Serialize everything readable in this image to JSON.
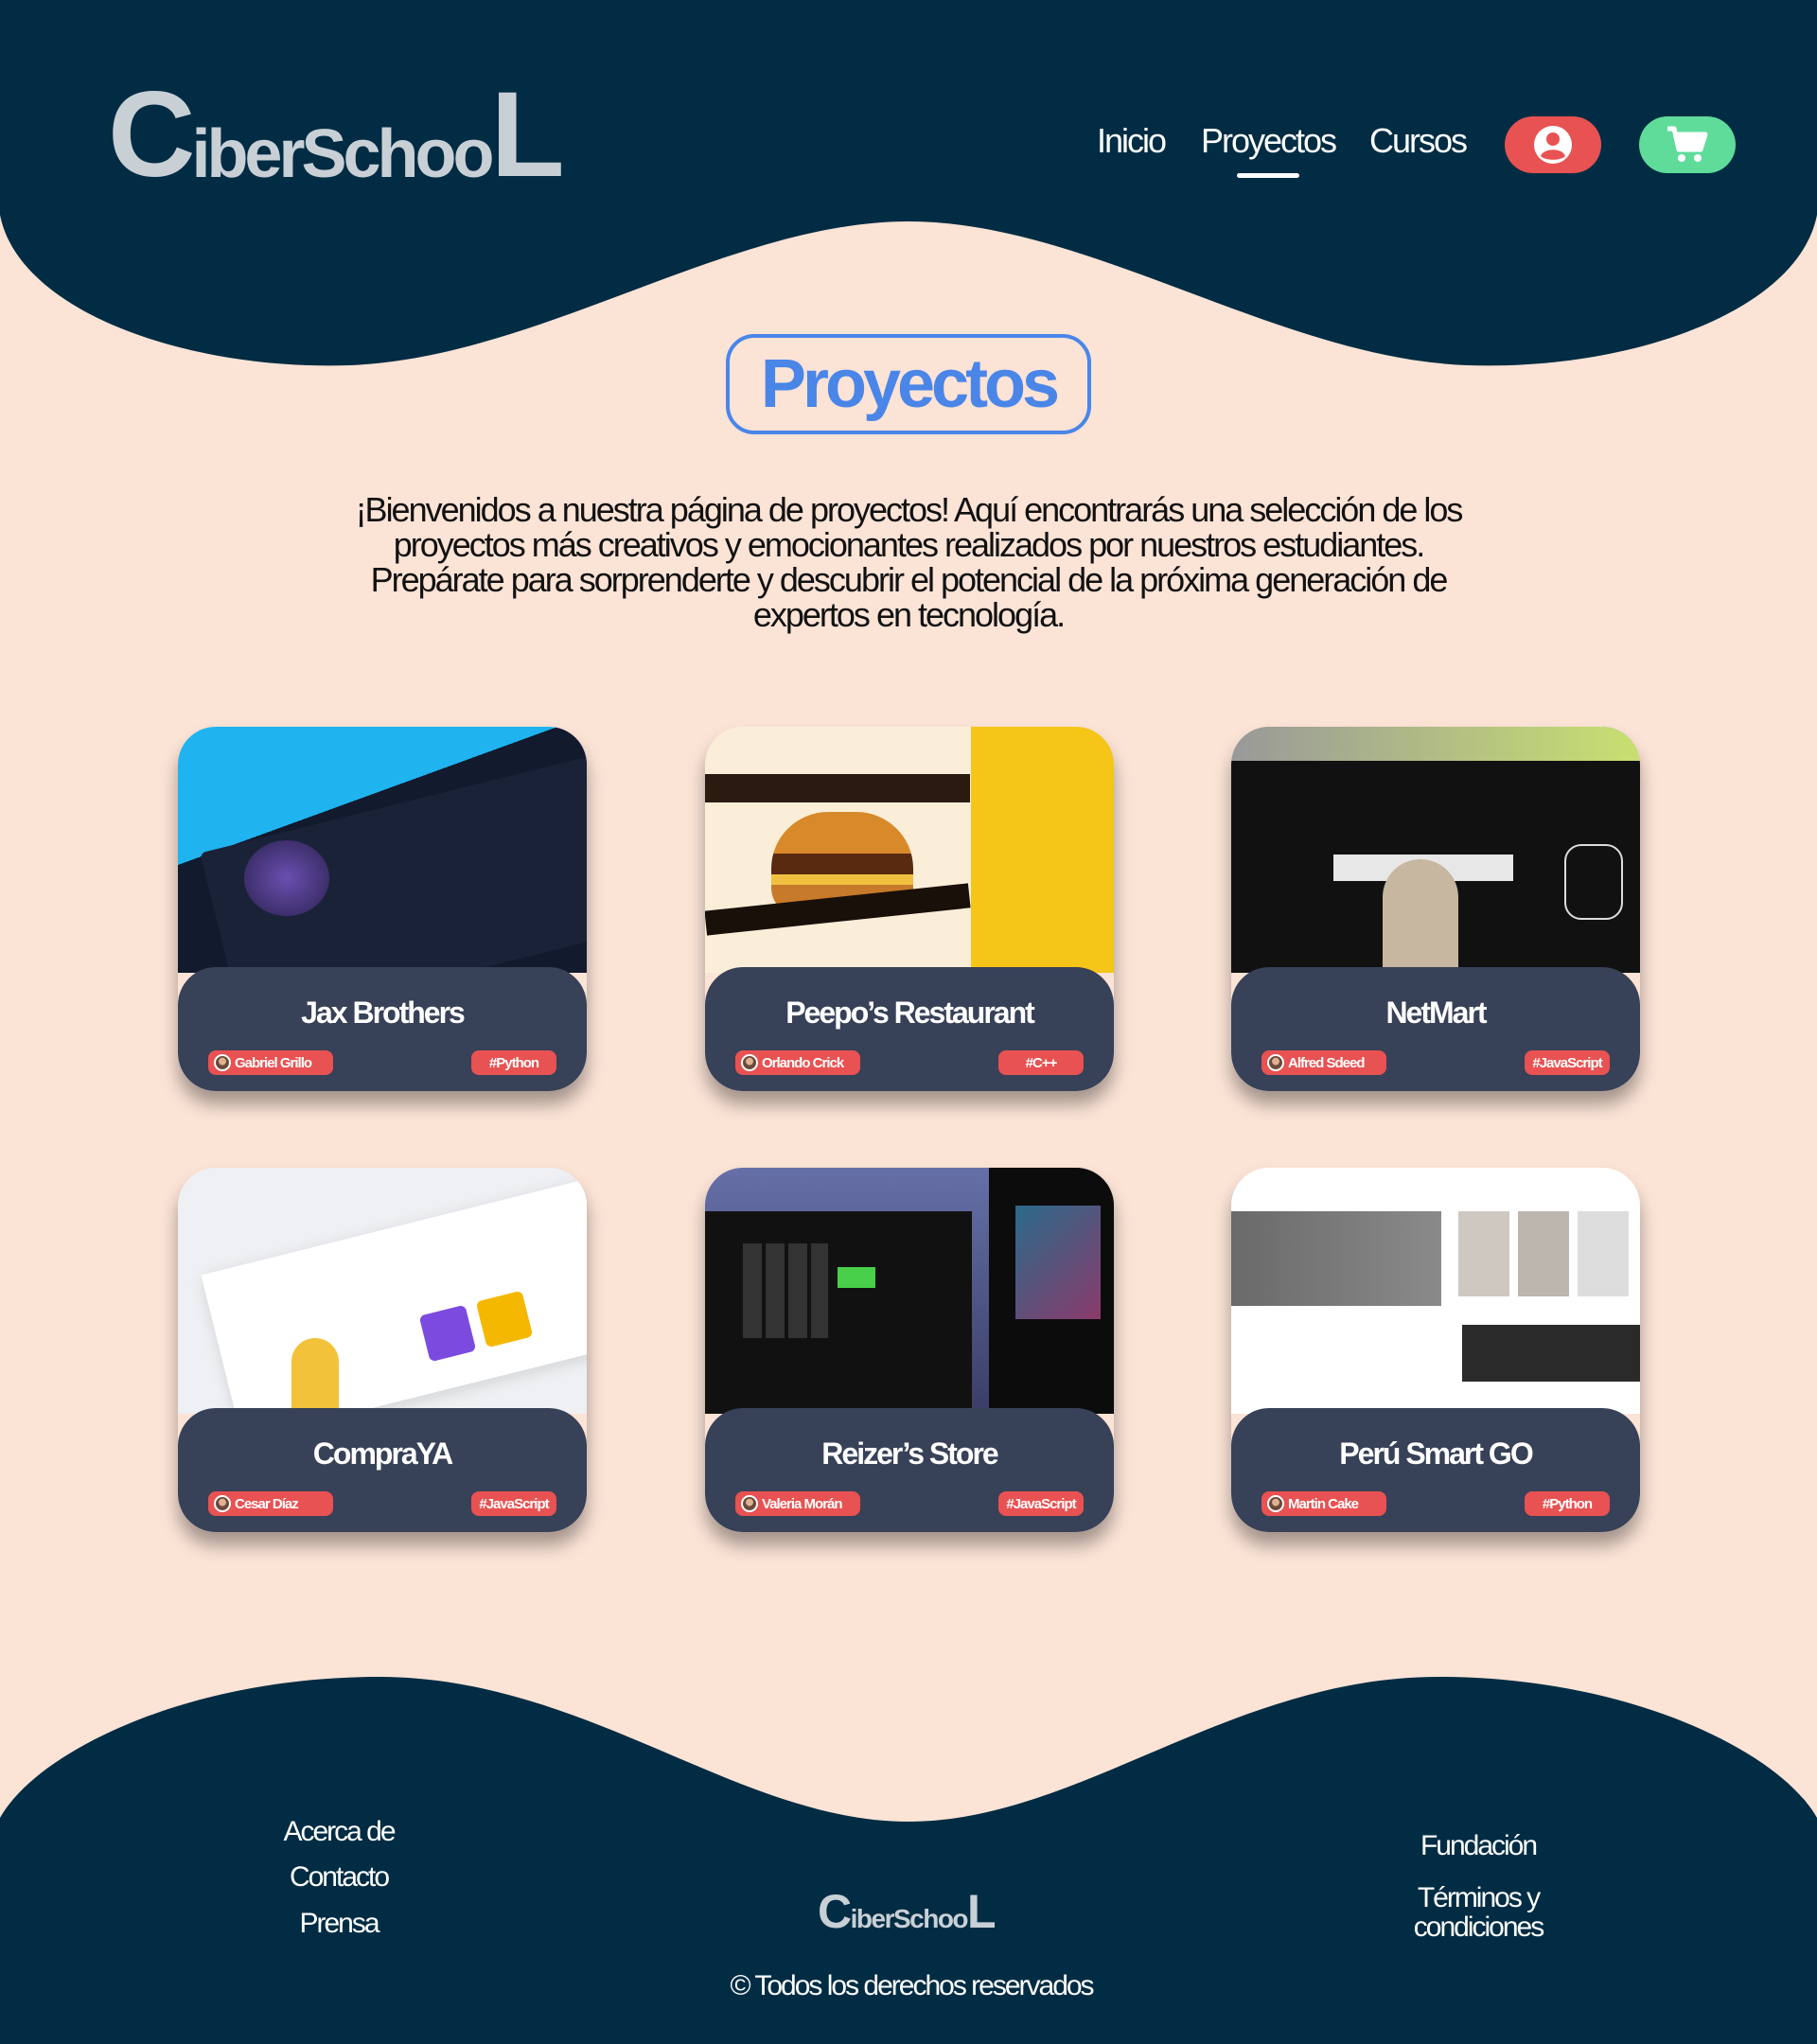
{
  "header": {
    "logo": {
      "c": "C",
      "mid": "iberSchoo",
      "l": "L"
    },
    "nav": [
      {
        "label": "Inicio"
      },
      {
        "label": "Proyectos",
        "active": true
      },
      {
        "label": "Cursos"
      }
    ],
    "user_icon": "user-circle-icon",
    "cart_icon": "cart-icon",
    "colors": {
      "dark": "#012c43",
      "user_button": "#e85252",
      "cart_button": "#5fdc9a"
    }
  },
  "main": {
    "title": "Proyectos",
    "intro": "¡Bienvenidos a nuestra página de proyectos! Aquí encontrarás una selección de los proyectos más creativos y emocionantes realizados por nuestros estudiantes. Prepárate para sorprenderte y descubrir el potencial de la próxima generación de expertos en tecnología.",
    "projects": [
      {
        "name": "Jax Brothers",
        "author": "Gabriel Grillo",
        "tag": "#Python"
      },
      {
        "name": "Peepo’s Restaurant",
        "author": "Orlando Crick",
        "tag": "#C++"
      },
      {
        "name": "NetMart",
        "author": "Alfred Sdeed",
        "tag": "#JavaScript"
      },
      {
        "name": "CompraYA",
        "author": "Cesar Díaz",
        "tag": "#JavaScript"
      },
      {
        "name": "Reizer’s Store",
        "author": "Valeria Morán",
        "tag": "#JavaScript"
      },
      {
        "name": "Perú Smart GO",
        "author": "Martin Cake",
        "tag": "#Python"
      }
    ]
  },
  "footer": {
    "left_links": [
      "Acerca de",
      "Contacto",
      "Prensa"
    ],
    "right_links": [
      "Fundación",
      "Términos y condiciones"
    ],
    "logo": {
      "c": "C",
      "mid": "iberSchoo",
      "l": "L"
    },
    "copyright": "© Todos los derechos reservados"
  }
}
